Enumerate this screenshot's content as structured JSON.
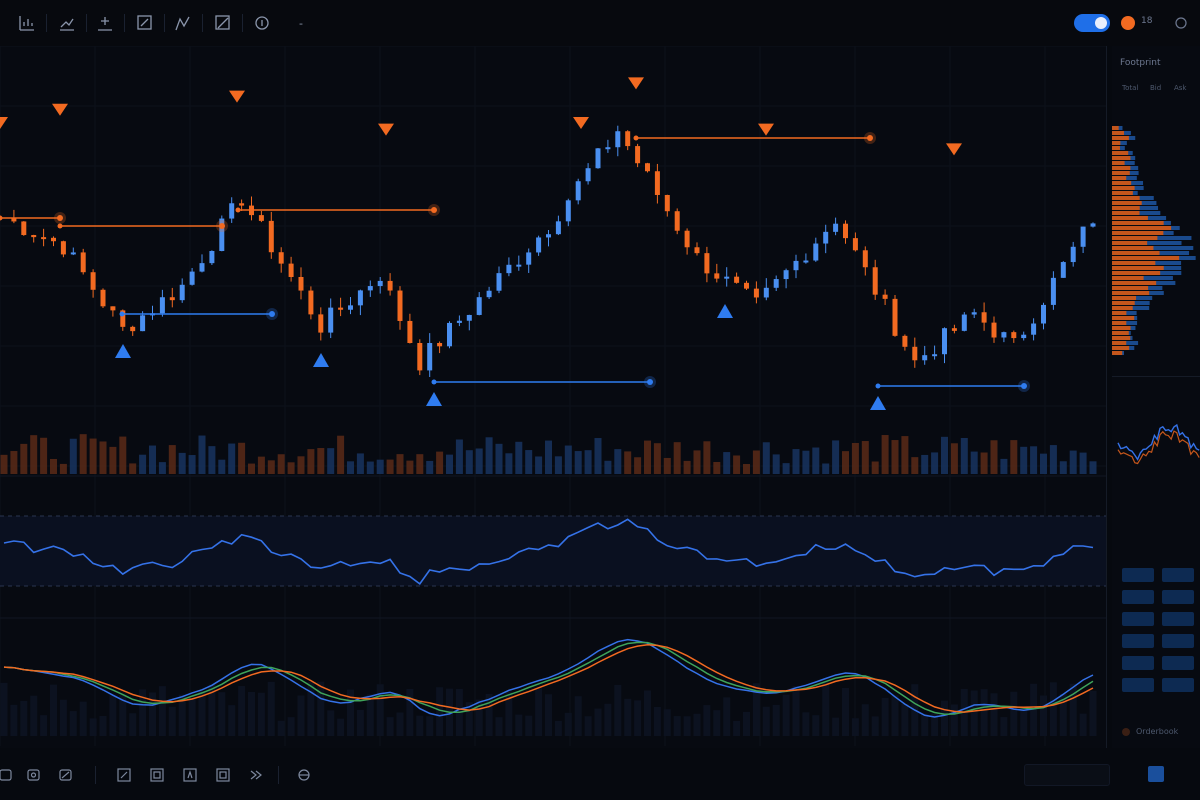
{
  "toolbar": {
    "tools": [
      {
        "icon": "bar-chart-icon"
      },
      {
        "icon": "trend-line-icon"
      },
      {
        "icon": "add-indicator-icon"
      },
      {
        "icon": "edit-drawing-icon"
      },
      {
        "icon": "zigzag-icon"
      },
      {
        "icon": "ray-tool-icon"
      },
      {
        "icon": "crosshair-icon"
      }
    ],
    "more_label": "-",
    "toggle_on": true,
    "status_label": "18"
  },
  "sidebar": {
    "title": "Footprint",
    "tabs": [
      "Total",
      "Bid",
      "Ask"
    ],
    "buttons": [
      "",
      "",
      "",
      "",
      "",
      "",
      "",
      "",
      "",
      "",
      "",
      ""
    ],
    "footer_label": "Orderbook"
  },
  "chart_data": {
    "type": "candlestick",
    "colors": {
      "up": "#4a8ff0",
      "down": "#f26a21",
      "volume_up": "#183460",
      "volume_down": "#5a2a18"
    },
    "price_line_levels": [
      {
        "price": 70,
        "color": "#f26a21"
      },
      {
        "price": 73,
        "color": "#f26a21"
      },
      {
        "price": 92,
        "color": "#f26a21"
      },
      {
        "price": 48,
        "color": "#2f7cf0"
      },
      {
        "price": 31,
        "color": "#2f7cf0"
      },
      {
        "price": 30,
        "color": "#2f7cf0"
      }
    ],
    "pivots": [
      {
        "type": "high",
        "price": 72
      },
      {
        "type": "high",
        "price": 77
      },
      {
        "type": "high",
        "price": 94
      },
      {
        "type": "high",
        "price": 60
      },
      {
        "type": "high",
        "price": 72
      },
      {
        "type": "high",
        "price": 48
      },
      {
        "type": "low",
        "price": 44
      },
      {
        "type": "low",
        "price": 46
      },
      {
        "type": "low",
        "price": 36
      },
      {
        "type": "low",
        "price": 50
      },
      {
        "type": "low",
        "price": 36
      }
    ],
    "oscillator": {
      "upper_band": 80,
      "lower_band": 20
    },
    "ma_colors": [
      "#3572e8",
      "#3fa35a",
      "#f26a21"
    ]
  }
}
